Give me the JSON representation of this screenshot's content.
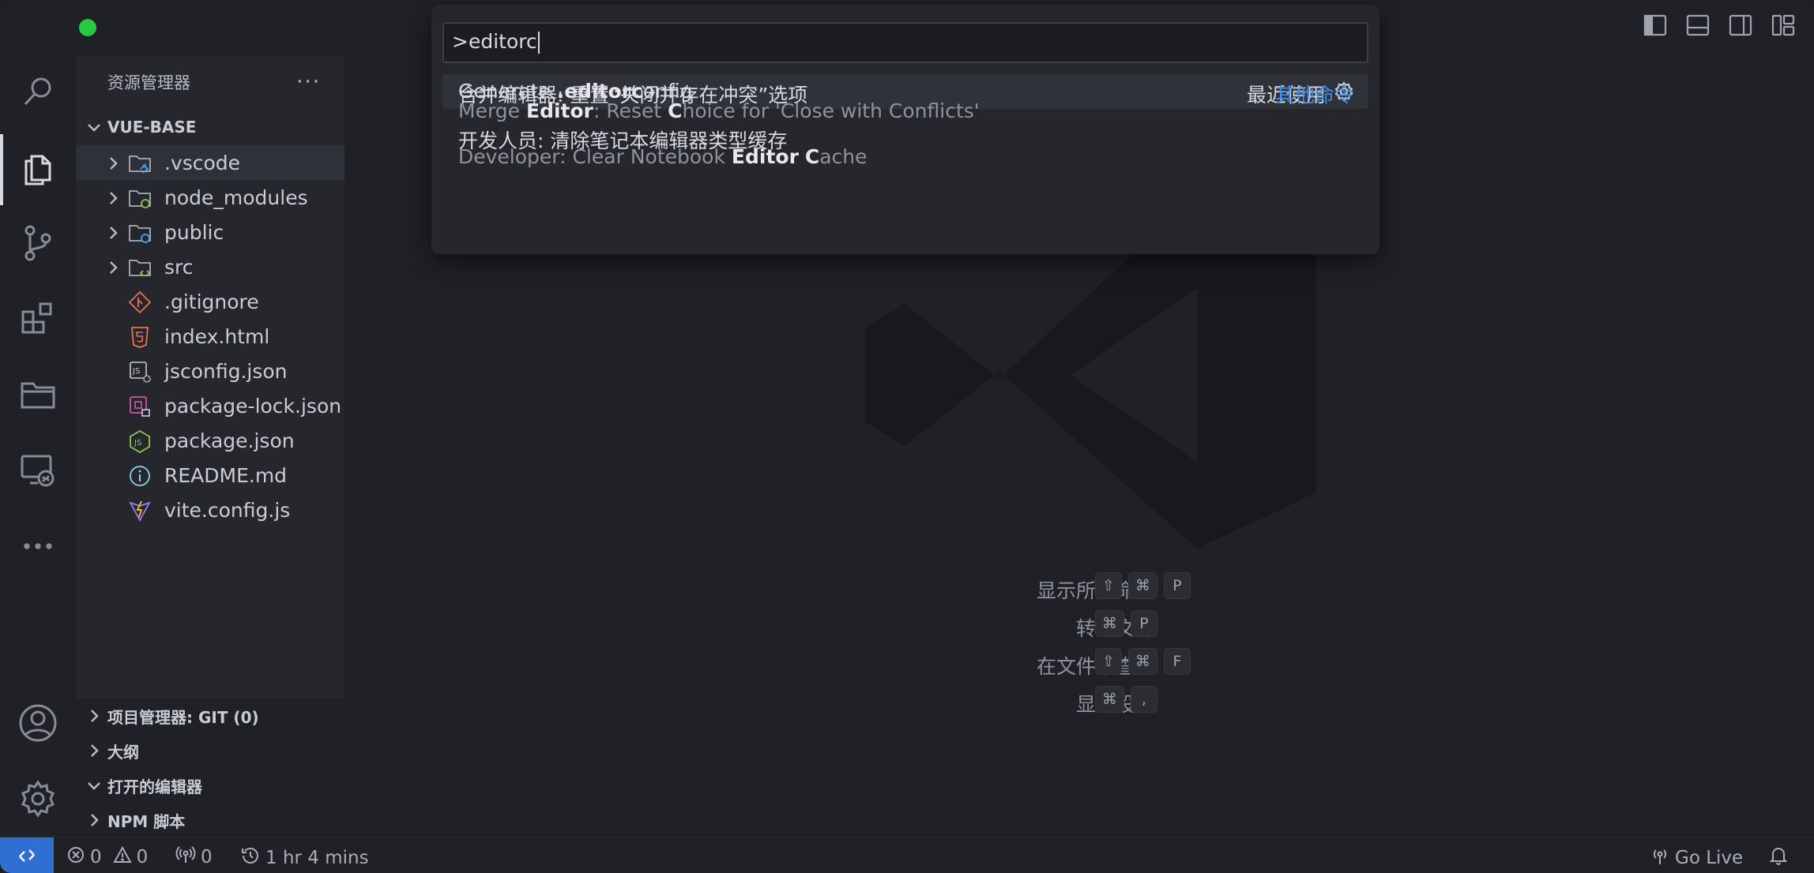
{
  "sidebar": {
    "title": "资源管理器",
    "more": "···",
    "project": "VUE-BASE",
    "tree": [
      {
        "name": ".vscode",
        "type": "folder",
        "icon": "vscode-folder-icon"
      },
      {
        "name": "node_modules",
        "type": "folder",
        "icon": "node-modules-folder-icon"
      },
      {
        "name": "public",
        "type": "folder",
        "icon": "public-folder-icon"
      },
      {
        "name": "src",
        "type": "folder",
        "icon": "src-folder-icon"
      },
      {
        "name": ".gitignore",
        "type": "file",
        "icon": "git-icon"
      },
      {
        "name": "index.html",
        "type": "file",
        "icon": "html5-icon"
      },
      {
        "name": "jsconfig.json",
        "type": "file",
        "icon": "jsconfig-icon"
      },
      {
        "name": "package-lock.json",
        "type": "file",
        "icon": "package-lock-icon"
      },
      {
        "name": "package.json",
        "type": "file",
        "icon": "nodejs-icon"
      },
      {
        "name": "README.md",
        "type": "file",
        "icon": "info-icon"
      },
      {
        "name": "vite.config.js",
        "type": "file",
        "icon": "vite-icon"
      }
    ],
    "sections": [
      "项目管理器: GIT (0)",
      "大纲",
      "打开的编辑器",
      "NPM 脚本"
    ]
  },
  "palette": {
    "input_value": ">editorc",
    "items": [
      {
        "main_pre": "Generate ",
        "main_bold": ".editorc",
        "main_post": "onfig",
        "right": "最近使用"
      },
      {
        "main": "合并编辑器: 重置“关闭并存在冲突”选项",
        "sub_pre": "Merge ",
        "sub_b1": "Editor",
        "sub_mid": ": Reset ",
        "sub_b2": "C",
        "sub_post": "hoice for 'Close with Conflicts'",
        "right": "其他命令"
      },
      {
        "main": "开发人员: 清除笔记本编辑器类型缓存",
        "sub_pre": "Developer: Clear Notebook ",
        "sub_b1": "Editor",
        "sub_mid": " ",
        "sub_b2": "C",
        "sub_post": "ache"
      }
    ]
  },
  "shortcuts": [
    {
      "label": "显示所有命令",
      "keys": [
        "⇧",
        "⌘",
        "P"
      ]
    },
    {
      "label": "转到文件",
      "keys": [
        "⌘",
        "P"
      ]
    },
    {
      "label": "在文件中查找",
      "keys": [
        "⇧",
        "⌘",
        "F"
      ]
    },
    {
      "label": "显示设置",
      "keys": [
        "⌘",
        ","
      ]
    }
  ],
  "status": {
    "errors": "0",
    "warnings": "0",
    "ports": "0",
    "time": "1 hr 4 mins",
    "golive": "Go Live"
  },
  "colors": {
    "accent": "#2f6fd1",
    "link": "#3d8fe8"
  }
}
